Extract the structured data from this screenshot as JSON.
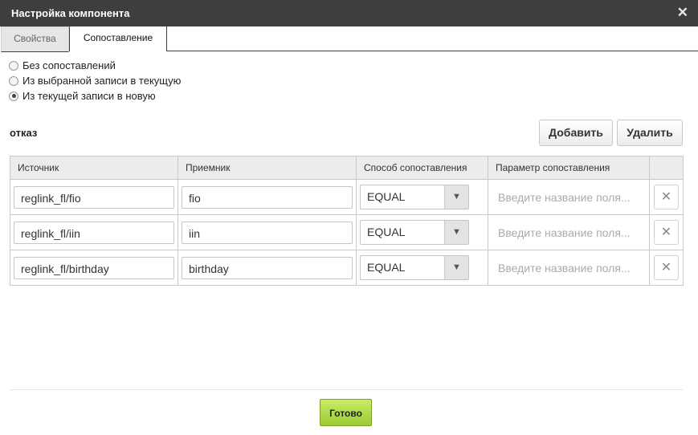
{
  "dialog": {
    "title": "Настройка компонента",
    "close_glyph": "✕"
  },
  "tabs": [
    {
      "label": "Свойства",
      "active": false
    },
    {
      "label": "Сопоставление",
      "active": true
    }
  ],
  "mapping_mode": {
    "options": [
      {
        "label": "Без сопоставлений",
        "checked": false
      },
      {
        "label": "Из выбранной записи в текущую",
        "checked": false
      },
      {
        "label": "Из текущей записи в новую",
        "checked": true
      }
    ]
  },
  "section": {
    "title": "отказ"
  },
  "toolbar": {
    "add_label": "Добавить",
    "delete_label": "Удалить"
  },
  "table": {
    "columns": [
      "Источник",
      "Приемник",
      "Способ сопоставления",
      "Параметр сопоставления",
      ""
    ],
    "rows": [
      {
        "source": "reglink_fl/fio",
        "target": "fio",
        "method": "EQUAL",
        "param_placeholder": "Введите название поля..."
      },
      {
        "source": "reglink_fl/iin",
        "target": "iin",
        "method": "EQUAL",
        "param_placeholder": "Введите название поля..."
      },
      {
        "source": "reglink_fl/birthday",
        "target": "birthday",
        "method": "EQUAL",
        "param_placeholder": "Введите название поля..."
      }
    ],
    "remove_icon": "close-icon",
    "dropdown_icon": "triangle-down-icon"
  },
  "footer": {
    "done_label": "Готово"
  },
  "colors": {
    "titlebar": "#3e3e3e",
    "done_button": "#a6d63c"
  }
}
